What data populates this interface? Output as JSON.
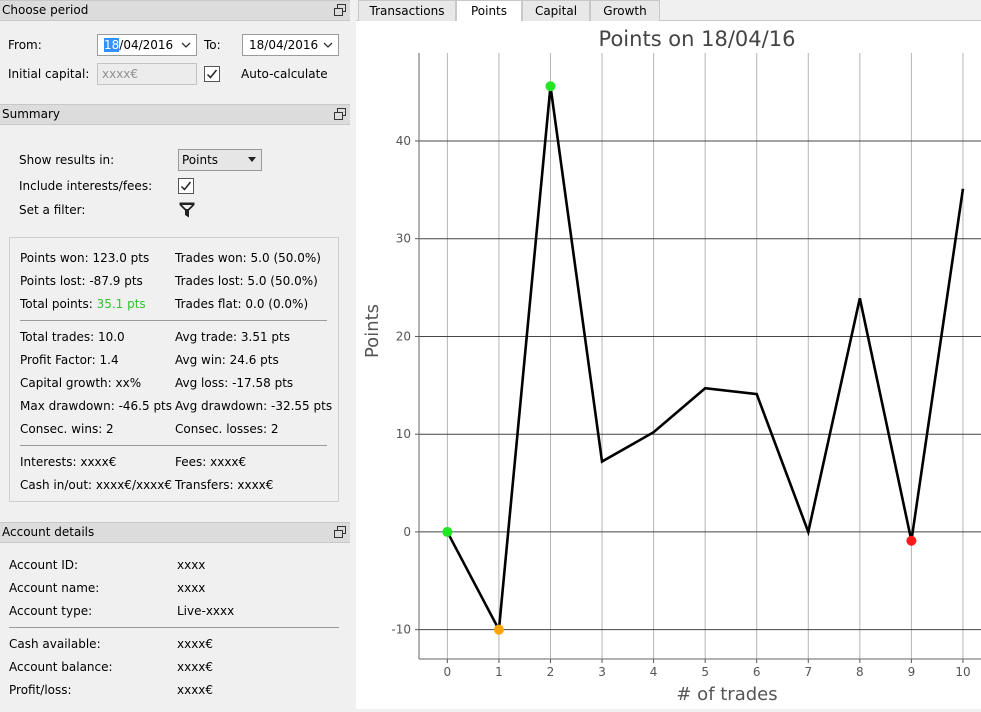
{
  "choose_period": {
    "title": "Choose period",
    "from_label": "From:",
    "from_selected": "18",
    "from_rest": "/04/2016",
    "to_label": "To:",
    "to_value": "18/04/2016",
    "initial_capital_label": "Initial capital:",
    "initial_capital_placeholder": "xxxx€",
    "auto_calculate_label": "Auto-calculate",
    "auto_calculate_checked": true
  },
  "summary": {
    "title": "Summary",
    "show_results_label": "Show results in:",
    "show_results_value": "Points",
    "include_interests_label": "Include interests/fees:",
    "include_interests_checked": true,
    "set_filter_label": "Set a filter:",
    "stats": {
      "points_won": "Points won: 123.0 pts",
      "trades_won": "Trades won: 5.0 (50.0%)",
      "points_lost": "Points lost: -87.9 pts",
      "trades_lost": "Trades lost: 5.0 (50.0%)",
      "total_points_label": "Total points: ",
      "total_points_value": "35.1 pts",
      "trades_flat": "Trades flat: 0.0 (0.0%)",
      "total_trades": "Total trades: 10.0",
      "avg_trade": "Avg trade: 3.51 pts",
      "profit_factor": "Profit Factor: 1.4",
      "avg_win": "Avg win: 24.6 pts",
      "capital_growth": "Capital growth: xx%",
      "avg_loss": "Avg loss: -17.58 pts",
      "max_drawdown": "Max drawdown: -46.5 pts",
      "avg_drawdown": "Avg drawdown: -32.55 pts",
      "consec_wins": "Consec. wins: 2",
      "consec_losses": "Consec. losses: 2",
      "interests": "Interests: xxxx€",
      "fees": "Fees: xxxx€",
      "cash_in_out": "Cash in/out: xxxx€/xxxx€",
      "transfers": "Transfers: xxxx€"
    }
  },
  "account_details": {
    "title": "Account details",
    "rows_top": [
      {
        "label": "Account ID:",
        "value": "xxxx"
      },
      {
        "label": "Account name:",
        "value": "xxxx"
      },
      {
        "label": "Account type:",
        "value": "Live-xxxx"
      }
    ],
    "rows_bottom": [
      {
        "label": "Cash available:",
        "value": "xxxx€"
      },
      {
        "label": "Account balance:",
        "value": "xxxx€"
      },
      {
        "label": "Profit/loss:",
        "value": "xxxx€"
      }
    ]
  },
  "tabs": [
    {
      "label": "Transactions",
      "active": false
    },
    {
      "label": "Points",
      "active": true
    },
    {
      "label": "Capital",
      "active": false
    },
    {
      "label": "Growth",
      "active": false
    }
  ],
  "colors": {
    "total_points_green": "#2ec42e",
    "max_marker": "#22e622",
    "min_marker": "#ff1a1a",
    "drawdown_marker": "#ffa500"
  },
  "chart_data": {
    "type": "line",
    "title": "Points on 18/04/16",
    "xlabel": "# of trades",
    "ylabel": "Points",
    "x": [
      0,
      1,
      2,
      3,
      4,
      5,
      6,
      7,
      8,
      9,
      10
    ],
    "y": [
      0,
      -10,
      45.6,
      7.2,
      10.2,
      14.7,
      14.1,
      0,
      23.9,
      -0.9,
      35.1
    ],
    "xlim": [
      -0.55,
      10.35
    ],
    "ylim": [
      -13,
      49
    ],
    "xticks": [
      0,
      1,
      2,
      3,
      4,
      5,
      6,
      7,
      8,
      9,
      10
    ],
    "yticks": [
      -10,
      0,
      10,
      20,
      30,
      40
    ],
    "grid": true,
    "markers": [
      {
        "x": 0,
        "y": 0,
        "color": "#22e622"
      },
      {
        "x": 1,
        "y": -10,
        "color": "#ffa500"
      },
      {
        "x": 2,
        "y": 45.6,
        "color": "#22e622"
      },
      {
        "x": 9,
        "y": -0.9,
        "color": "#ff1a1a"
      }
    ]
  }
}
